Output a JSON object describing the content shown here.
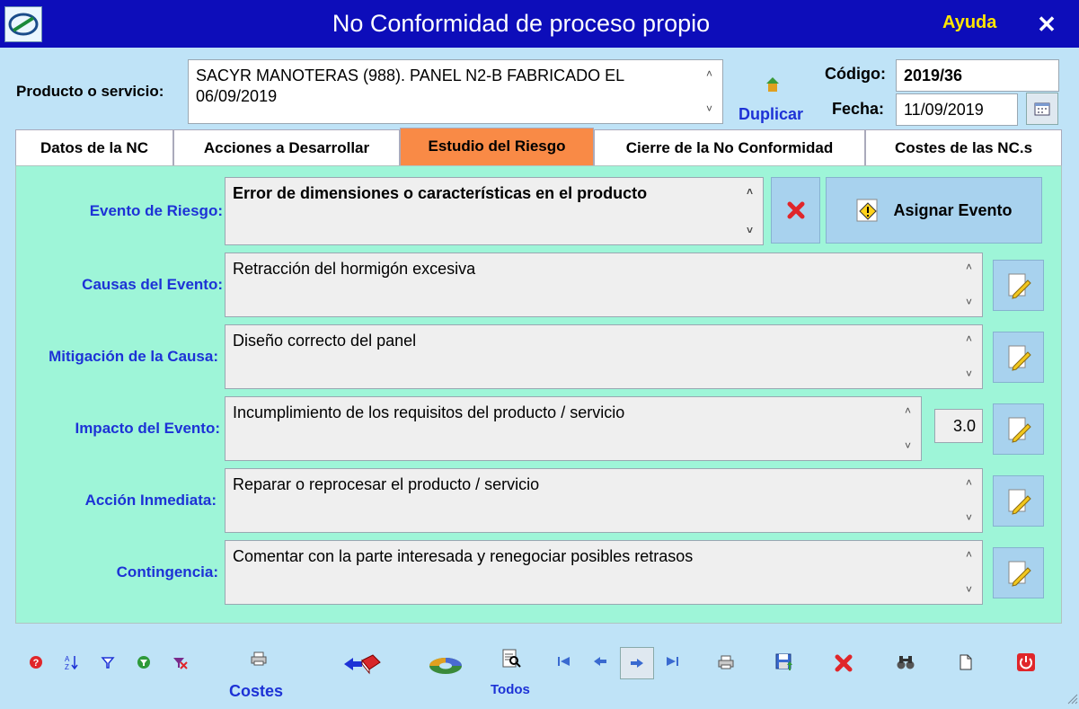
{
  "window": {
    "title": "No Conformidad de proceso propio",
    "help": "Ayuda",
    "close": "✕"
  },
  "header": {
    "product_label": "Producto o servicio:",
    "product_value": "SACYR MANOTERAS (988). PANEL N2-B FABRICADO EL 06/09/2019",
    "duplicate_label": "Duplicar",
    "code_label": "Código:",
    "code_value": "2019/36",
    "date_label": "Fecha:",
    "date_value": "11/09/2019"
  },
  "tabs": [
    {
      "label": "Datos de la NC"
    },
    {
      "label": "Acciones a Desarrollar"
    },
    {
      "label": "Estudio del Riesgo"
    },
    {
      "label": "Cierre de la No Conformidad"
    },
    {
      "label": "Costes de las NC.s"
    }
  ],
  "risk": {
    "event_label": "Evento de Riesgo:",
    "event_value": "Error de dimensiones o características en el producto",
    "assign_label": "Asignar Evento",
    "causes_label": "Causas del Evento:",
    "causes_value": "Retracción del hormigón excesiva",
    "mitigation_label": "Mitigación de la Causa:",
    "mitigation_value": "Diseño correcto del panel",
    "impact_label": "Impacto del Evento:",
    "impact_value": "Incumplimiento de los requisitos del producto / servicio",
    "impact_score": "3.0",
    "immediate_label": "Acción Inmediata:",
    "immediate_value": "Reparar o reprocesar el producto / servicio",
    "contingency_label": "Contingencia:",
    "contingency_value": "Comentar con la parte interesada y renegociar posibles retrasos"
  },
  "toolbar": {
    "costes_label": "Costes",
    "todos_label": "Todos"
  },
  "colors": {
    "title_bar": "#0d0dba",
    "help": "#ffe600",
    "active_tab": "#f98a46",
    "panel": "#9ef5d8",
    "background": "#bfe3f7",
    "label_blue": "#1d32d6"
  }
}
